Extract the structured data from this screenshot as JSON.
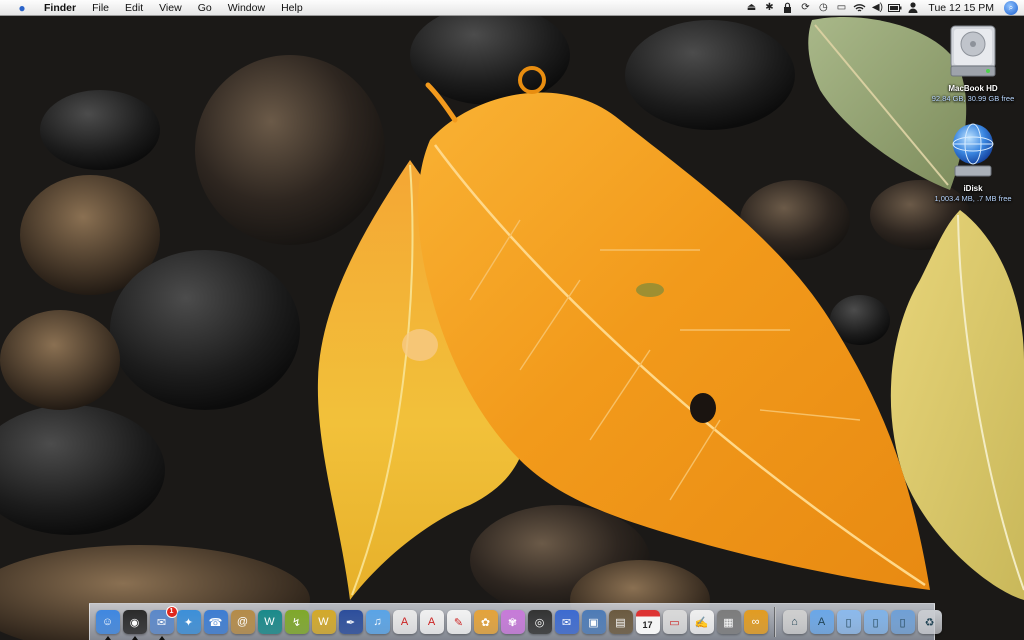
{
  "menubar": {
    "apple_icon": "apple-icon",
    "items": [
      "Finder",
      "File",
      "Edit",
      "View",
      "Go",
      "Window",
      "Help"
    ],
    "status_icons": [
      "eject-icon",
      "bluetooth-icon",
      "lock-icon",
      "sync-icon",
      "time-machine-icon",
      "screen-icon",
      "wifi-icon",
      "volume-icon",
      "battery-icon",
      "user-icon"
    ],
    "clock": "Tue 12 15 PM",
    "spotlight_icon": "spotlight-search-icon"
  },
  "desktop": {
    "icons": [
      {
        "title": "MacBook HD",
        "subtitle": "92.84 GB, 30.99 GB free",
        "icon": "hard-drive-icon"
      },
      {
        "title": "iDisk",
        "subtitle": "1,003.4 MB, .7 MB free",
        "icon": "idisk-globe-icon"
      }
    ]
  },
  "dock": {
    "items": [
      {
        "name": "finder",
        "color": "#3f87e0",
        "glyph": "☺",
        "running": true
      },
      {
        "name": "dashboard",
        "color": "#2a2a2a",
        "glyph": "◉",
        "running": true
      },
      {
        "name": "mail",
        "color": "#5b88c9",
        "glyph": "✉",
        "running": true,
        "badge": "1"
      },
      {
        "name": "safari",
        "color": "#3c8fd8",
        "glyph": "✦",
        "running": false
      },
      {
        "name": "ichat",
        "color": "#3d7dd2",
        "glyph": "☎",
        "running": false
      },
      {
        "name": "address-book",
        "color": "#b48b48",
        "glyph": "@",
        "running": false
      },
      {
        "name": "dreamweaver",
        "color": "#1a8a8a",
        "glyph": "W",
        "running": false
      },
      {
        "name": "flash",
        "color": "#7fa82a",
        "glyph": "↯",
        "running": false
      },
      {
        "name": "fireworks",
        "color": "#d3a92a",
        "glyph": "W",
        "running": false
      },
      {
        "name": "pen-tool",
        "color": "#2c4e9c",
        "glyph": "✒",
        "running": false
      },
      {
        "name": "itunes",
        "color": "#5aa4e6",
        "glyph": "♫",
        "running": false
      },
      {
        "name": "acrobat",
        "color": "#e8e8e8",
        "glyph": "A",
        "running": false
      },
      {
        "name": "acrobat-reader",
        "color": "#f0f0f0",
        "glyph": "A",
        "running": false
      },
      {
        "name": "illustrator-feather",
        "color": "#f2f2f2",
        "glyph": "✎",
        "running": false
      },
      {
        "name": "flower-app",
        "color": "#e4a33a",
        "glyph": "✿",
        "running": false
      },
      {
        "name": "orchid-app",
        "color": "#c77ad9",
        "glyph": "✾",
        "running": false
      },
      {
        "name": "aperture",
        "color": "#333333",
        "glyph": "◎",
        "running": false
      },
      {
        "name": "preview",
        "color": "#3c6ad0",
        "glyph": "✉",
        "running": false
      },
      {
        "name": "iphoto",
        "color": "#4d7bb6",
        "glyph": "▣",
        "running": false
      },
      {
        "name": "photos",
        "color": "#6b5a3f",
        "glyph": "▤",
        "running": false
      },
      {
        "name": "ical",
        "color": "#f3f3f3",
        "glyph": "",
        "running": false
      },
      {
        "name": "scanner",
        "color": "#d9d9d9",
        "glyph": "▭",
        "running": false
      },
      {
        "name": "notes",
        "color": "#efefef",
        "glyph": "✍",
        "running": false
      },
      {
        "name": "calculator",
        "color": "#7c7c7c",
        "glyph": "▦",
        "running": false
      },
      {
        "name": "bridge",
        "color": "#e29c21",
        "glyph": "∞",
        "running": false
      }
    ],
    "ical_day": "17",
    "stacks": [
      {
        "name": "home-folder",
        "color": "#cfcfcf",
        "glyph": "⌂"
      },
      {
        "name": "applications-folder",
        "color": "#6aa7e8",
        "glyph": "A"
      },
      {
        "name": "documents-folder",
        "color": "#8bb9ec",
        "glyph": "▯"
      },
      {
        "name": "downloads-folder",
        "color": "#7fb2e8",
        "glyph": "▯"
      },
      {
        "name": "pictures-folder",
        "color": "#6fa0d6",
        "glyph": "▯"
      },
      {
        "name": "trash",
        "color": "#c9ccd1",
        "glyph": "♻"
      }
    ]
  }
}
